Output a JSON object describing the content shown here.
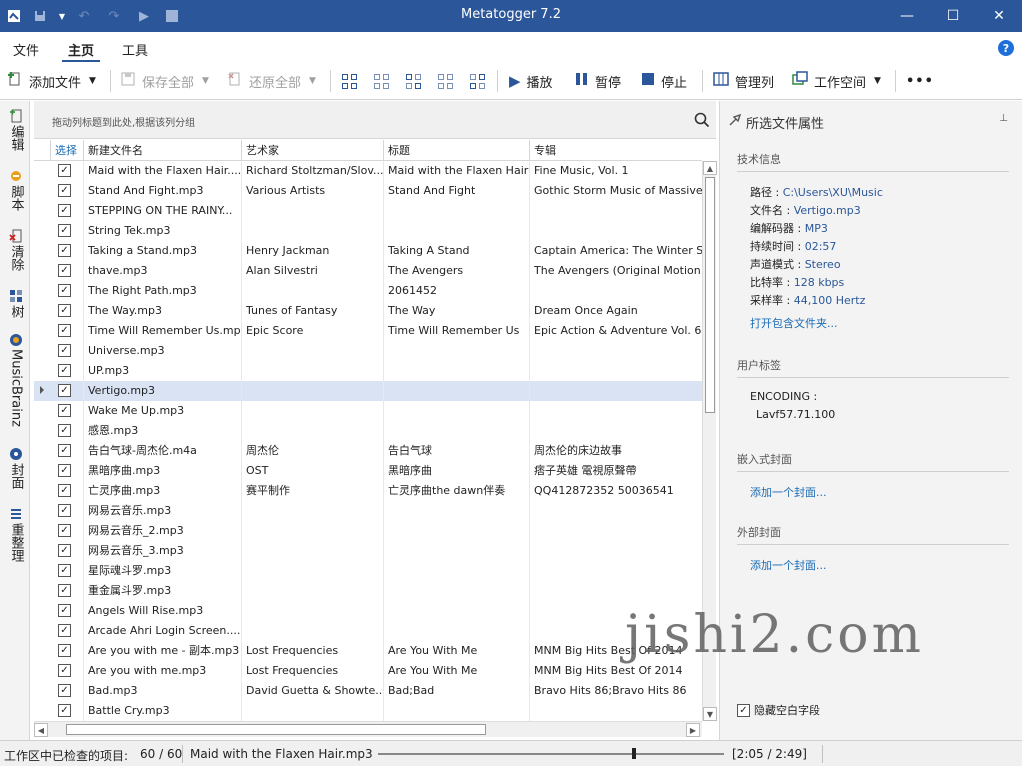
{
  "window": {
    "title": "Metatogger 7.2",
    "minimize": "—",
    "maximize": "☐",
    "close": "✕"
  },
  "menu": {
    "items": [
      "文件",
      "主页",
      "工具"
    ],
    "help": "?"
  },
  "toolbar": {
    "add_files": "添加文件",
    "save_all": "保存全部",
    "restore_all": "还原全部",
    "play": "播放",
    "pause": "暂停",
    "stop": "停止",
    "manage_columns": "管理列",
    "workspace": "工作空间",
    "more": "•••"
  },
  "leftbar": {
    "items": [
      "编辑",
      "脚本",
      "清除",
      "树",
      "MusicBrainz",
      "封面",
      "重整理"
    ]
  },
  "grid": {
    "group_hint": "拖动列标题到此处,根据该列分组",
    "columns": [
      "选择",
      "新建文件名",
      "艺术家",
      "标题",
      "专辑"
    ],
    "rows": [
      {
        "file": "Maid with the Flaxen Hair....",
        "artist": "Richard Stoltzman/Slov...",
        "title": "Maid with the Flaxen Hair",
        "album": "Fine Music, Vol. 1"
      },
      {
        "file": "Stand And Fight.mp3",
        "artist": "Various Artists",
        "title": "Stand And Fight",
        "album": "Gothic Storm Music of Massive"
      },
      {
        "file": "STEPPING ON THE RAINY...",
        "artist": "",
        "title": "",
        "album": ""
      },
      {
        "file": "String Tek.mp3",
        "artist": "",
        "title": "",
        "album": ""
      },
      {
        "file": "Taking a Stand.mp3",
        "artist": "Henry Jackman",
        "title": "Taking A Stand",
        "album": "Captain America: The Winter Sol"
      },
      {
        "file": "thave.mp3",
        "artist": "Alan Silvestri",
        "title": "The Avengers",
        "album": "The Avengers (Original Motion I"
      },
      {
        "file": "The Right Path.mp3",
        "artist": "",
        "title": "2061452",
        "album": ""
      },
      {
        "file": "The Way.mp3",
        "artist": "Tunes of Fantasy",
        "title": "The Way",
        "album": "Dream Once Again"
      },
      {
        "file": "Time Will Remember Us.mp3",
        "artist": "Epic Score",
        "title": "Time Will Remember Us",
        "album": "Epic Action & Adventure Vol. 6"
      },
      {
        "file": "Universe.mp3",
        "artist": "",
        "title": "",
        "album": ""
      },
      {
        "file": "UP.mp3",
        "artist": "",
        "title": "",
        "album": ""
      },
      {
        "file": "Vertigo.mp3",
        "artist": "",
        "title": "",
        "album": ""
      },
      {
        "file": "Wake Me Up.mp3",
        "artist": "",
        "title": "",
        "album": ""
      },
      {
        "file": "感恩.mp3",
        "artist": "",
        "title": "",
        "album": ""
      },
      {
        "file": "告白气球-周杰伦.m4a",
        "artist": "周杰伦",
        "title": "告白气球",
        "album": "周杰伦的床边故事"
      },
      {
        "file": "黑暗序曲.mp3",
        "artist": "OST",
        "title": "黑暗序曲",
        "album": "痞子英雄 電視原聲帶"
      },
      {
        "file": "亡灵序曲.mp3",
        "artist": "赛平制作",
        "title": "亡灵序曲the dawn伴奏",
        "album": "QQ412872352  50036541"
      },
      {
        "file": "网易云音乐.mp3",
        "artist": "",
        "title": "",
        "album": ""
      },
      {
        "file": "网易云音乐_2.mp3",
        "artist": "",
        "title": "",
        "album": ""
      },
      {
        "file": "网易云音乐_3.mp3",
        "artist": "",
        "title": "",
        "album": ""
      },
      {
        "file": "星际魂斗罗.mp3",
        "artist": "",
        "title": "",
        "album": ""
      },
      {
        "file": "重金属斗罗.mp3",
        "artist": "",
        "title": "",
        "album": ""
      },
      {
        "file": "Angels Will Rise.mp3",
        "artist": "",
        "title": "",
        "album": ""
      },
      {
        "file": "Arcade Ahri Login Screen....",
        "artist": "",
        "title": "",
        "album": ""
      },
      {
        "file": "Are you with me - 副本.mp3",
        "artist": "Lost Frequencies",
        "title": "Are You With Me",
        "album": "MNM Big Hits Best Of 2014"
      },
      {
        "file": "Are you with me.mp3",
        "artist": "Lost Frequencies",
        "title": "Are You With Me",
        "album": "MNM Big Hits Best Of 2014"
      },
      {
        "file": "Bad.mp3",
        "artist": "David Guetta & Showte...",
        "title": "Bad;Bad",
        "album": "Bravo Hits 86;Bravo Hits 86"
      },
      {
        "file": "Battle Cry.mp3",
        "artist": "",
        "title": "",
        "album": ""
      }
    ]
  },
  "props": {
    "title": "所选文件属性",
    "pin": "⊥",
    "tech_section": "技术信息",
    "path_label": "路径 : ",
    "path_value": "C:\\Users\\XU\\Music",
    "name_label": "文件名 : ",
    "name_value": "Vertigo.mp3",
    "codec_label": "编解码器 : ",
    "codec_value": "MP3",
    "duration_label": "持续时间 : ",
    "duration_value": "02:57",
    "channel_label": "声道模式 : ",
    "channel_value": "Stereo",
    "bitrate_label": "比特率 : ",
    "bitrate_value": "128 kbps",
    "samplerate_label": "采样率 : ",
    "samplerate_value": "44,100 Hertz",
    "open_folder": "打开包含文件夹...",
    "user_tags_section": "用户标签",
    "encoding_label": "ENCODING :",
    "encoding_value": "Lavf57.71.100",
    "embedded_cover_section": "嵌入式封面",
    "add_cover": "添加一个封面...",
    "external_cover_section": "外部封面",
    "add_cover2": "添加一个封面...",
    "hide_empty": "隐藏空白字段"
  },
  "status": {
    "checked_label": "工作区中已检查的项目:",
    "checked_value": "60 / 60",
    "current_file": "Maid with the Flaxen Hair.mp3",
    "time": "[2:05 / 2:49]",
    "progress": 0.74
  },
  "watermark": "jishi2.com"
}
